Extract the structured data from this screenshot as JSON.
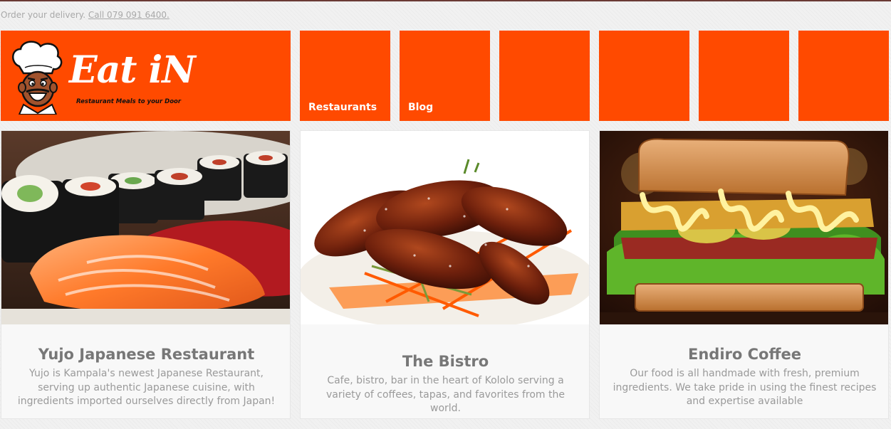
{
  "topbar": {
    "delivery_text": "Order your delivery.",
    "call_link": "Call 079 091 6400."
  },
  "header": {
    "brand_name": "Eat iN",
    "tagline": "Restaurant Meals to your Door",
    "nav": [
      {
        "label": "Restaurants"
      },
      {
        "label": "Blog"
      },
      {
        "label": ""
      },
      {
        "label": ""
      },
      {
        "label": ""
      },
      {
        "label": ""
      }
    ],
    "accent_color": "#ff4a00"
  },
  "restaurants": [
    {
      "name": "Yujo Japanese Restaurant",
      "description": "Yujo is Kampala's newest Japanese Restaurant, serving up authentic Japanese cuisine, with ingredients imported ourselves directly from Japan!",
      "image_icon": "sushi-photo"
    },
    {
      "name": "The Bistro",
      "description": "Cafe, bistro, bar in the heart of Kololo serving a variety of coffees, tapas, and favorites from the world.",
      "image_icon": "chicken-wings-photo"
    },
    {
      "name": "Endiro Coffee",
      "description": "Our food is all handmade with fresh, premium ingredients. We take pride in using the finest recipes and expertise available",
      "image_icon": "sandwich-photo"
    }
  ]
}
